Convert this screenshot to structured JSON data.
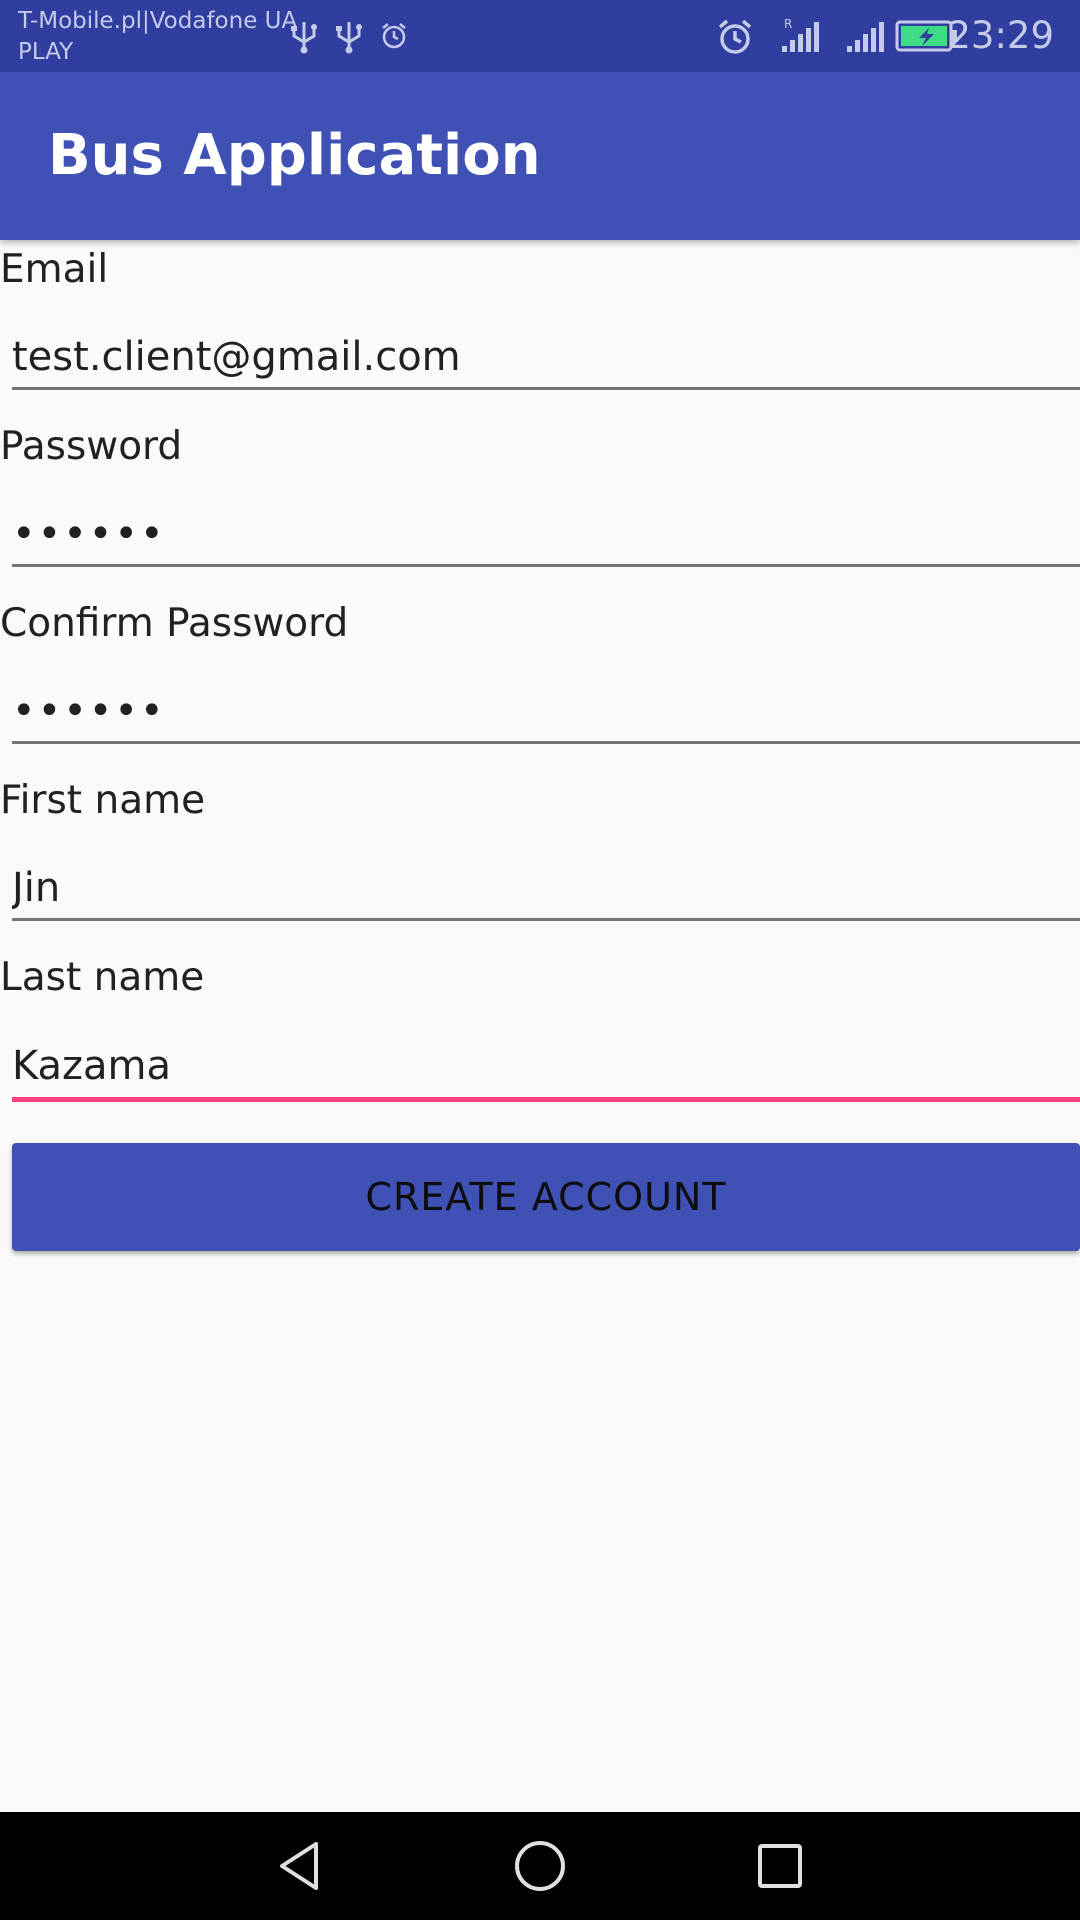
{
  "status_bar": {
    "carrier_line1": "T-Mobile.pl|Vodafone UA",
    "carrier_line2": "PLAY",
    "time": "23:29",
    "icons": [
      "usb-icon",
      "usb-icon",
      "alarm-icon",
      "alarm-icon",
      "signal-roaming-icon",
      "signal-icon",
      "battery-charging-icon"
    ]
  },
  "app_bar": {
    "title": "Bus Application"
  },
  "form": {
    "email_label": "Email",
    "email_value": "test.client@gmail.com",
    "password_label": "Password",
    "password_value": "••••••",
    "confirm_label": "Confirm Password",
    "confirm_value": "••••••",
    "first_name_label": "First name",
    "first_name_value": "Jin",
    "last_name_label": "Last name",
    "last_name_value": "Kazama",
    "submit_label": "CREATE ACCOUNT"
  },
  "colors": {
    "status_bar": "#303f9f",
    "primary": "#3f51b5",
    "accent": "#ff4081",
    "background": "#fafafa"
  },
  "nav_bar": {
    "icons": [
      "back-icon",
      "home-icon",
      "recents-icon"
    ]
  }
}
